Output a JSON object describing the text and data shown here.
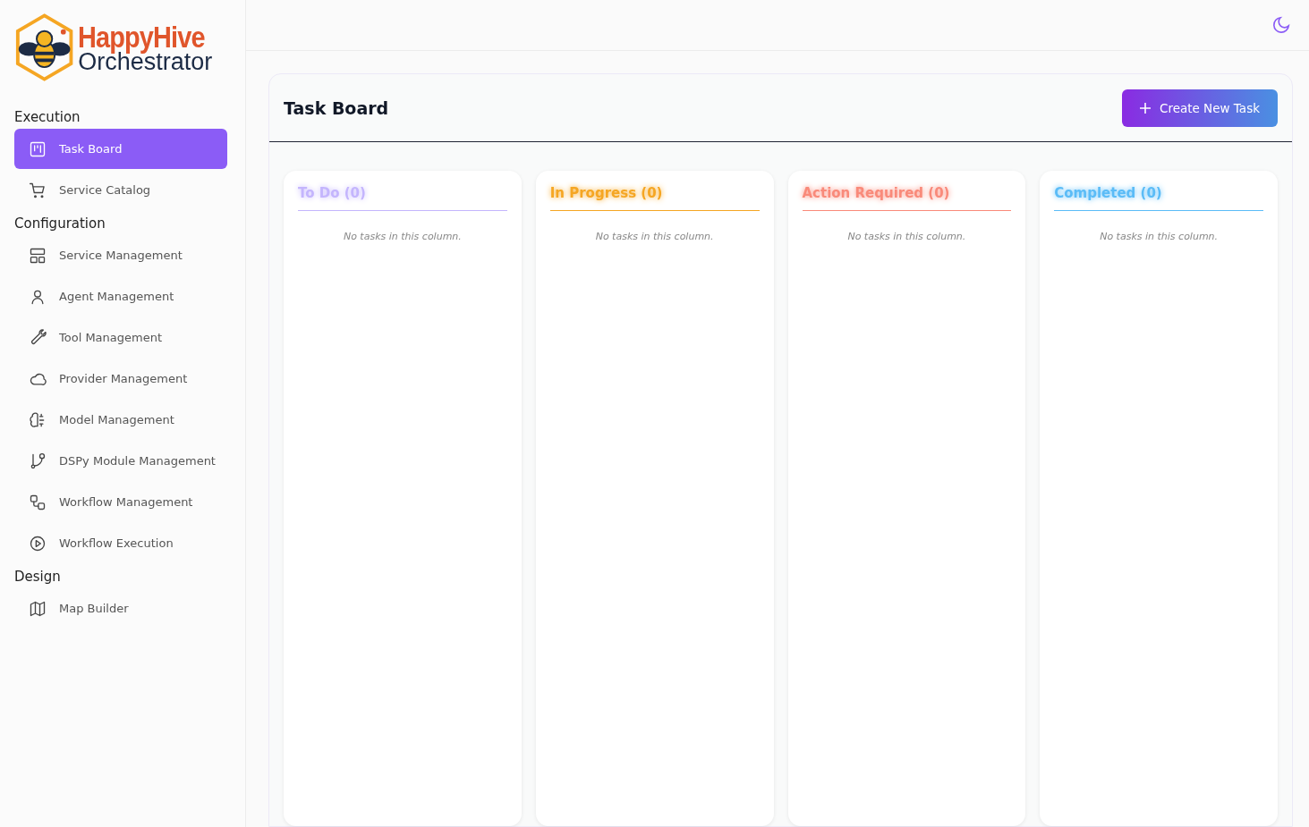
{
  "brand": {
    "name": "HappyHive",
    "subtitle": "Orchestrator"
  },
  "sidebar": {
    "sections": [
      {
        "title": "Execution",
        "items": [
          {
            "label": "Task Board",
            "selected": true
          },
          {
            "label": "Service Catalog",
            "selected": false
          }
        ]
      },
      {
        "title": "Configuration",
        "items": [
          {
            "label": "Service Management",
            "selected": false
          },
          {
            "label": "Agent Management",
            "selected": false
          },
          {
            "label": "Tool Management",
            "selected": false
          },
          {
            "label": "Provider Management",
            "selected": false
          },
          {
            "label": "Model Management",
            "selected": false
          },
          {
            "label": "DSPy Module Management",
            "selected": false
          },
          {
            "label": "Workflow Management",
            "selected": false
          },
          {
            "label": "Workflow Execution",
            "selected": false
          }
        ]
      },
      {
        "title": "Design",
        "items": [
          {
            "label": "Map Builder",
            "selected": false
          }
        ]
      }
    ]
  },
  "board": {
    "title": "Task Board",
    "create_button": "Create New Task",
    "columns": [
      {
        "title": "To Do (0)",
        "color": "#c4b5fd",
        "empty": "No tasks in this column."
      },
      {
        "title": "In Progress (0)",
        "color": "#f5a623",
        "empty": "No tasks in this column."
      },
      {
        "title": "Action Required (0)",
        "color": "#f98a7a",
        "empty": "No tasks in this column."
      },
      {
        "title": "Completed (0)",
        "color": "#5bbcf7",
        "empty": "No tasks in this column."
      }
    ]
  }
}
